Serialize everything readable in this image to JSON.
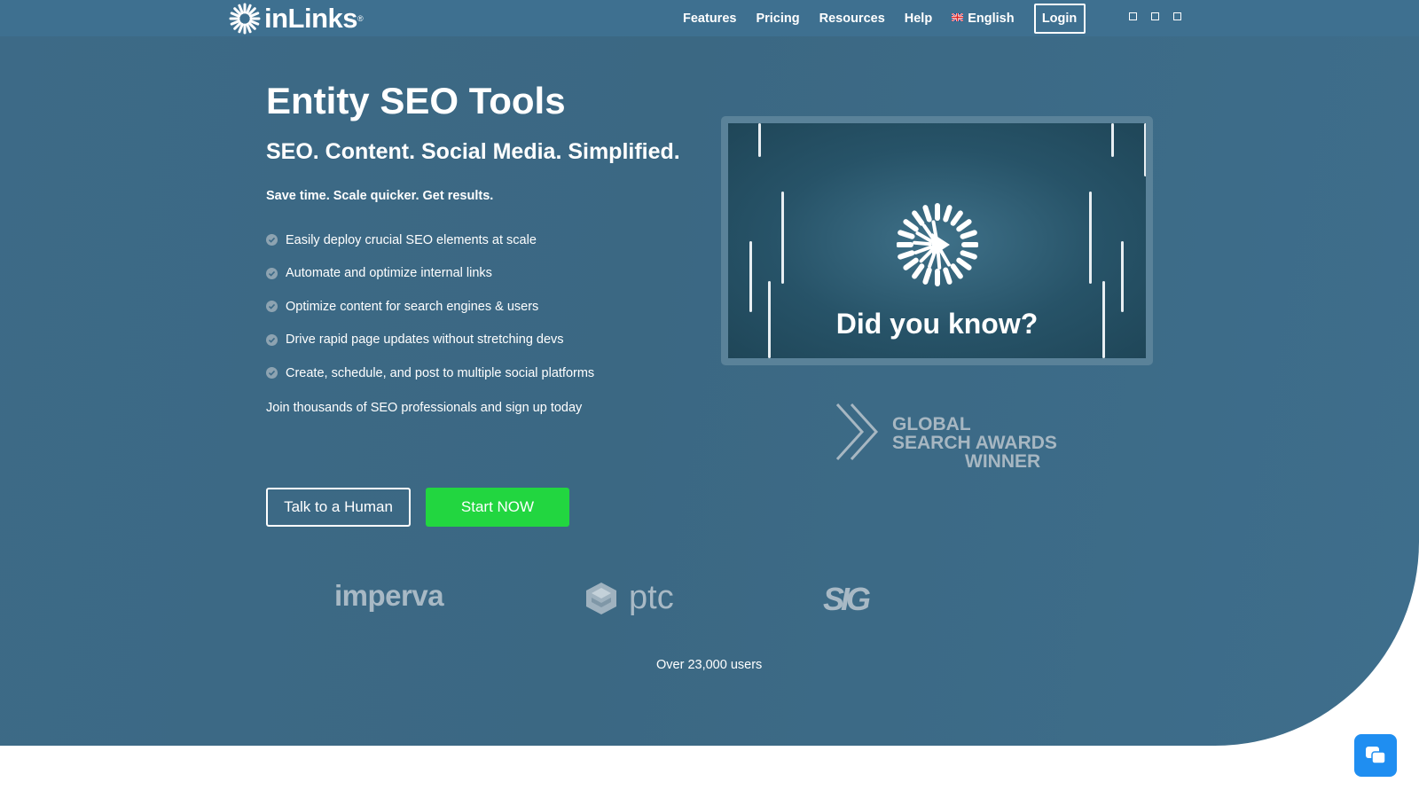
{
  "brand": {
    "logo_text": "inLinks",
    "registered": "®"
  },
  "nav": {
    "links": [
      "Features",
      "Pricing",
      "Resources",
      "Help"
    ],
    "language": "English",
    "login": "Login"
  },
  "hero": {
    "title": "Entity SEO Tools",
    "subtitle": "SEO. Content. Social Media. Simplified.",
    "tagline": "Save time. Scale quicker. Get results.",
    "features": [
      "Easily deploy crucial SEO elements at scale",
      "Automate and optimize internal links",
      "Optimize content for search engines & users",
      "Drive rapid page updates without stretching devs",
      "Create, schedule, and post to multiple social platforms"
    ],
    "join_text": "Join thousands of SEO professionals and sign up today",
    "buttons": {
      "talk": "Talk to a Human",
      "start": "Start NOW"
    }
  },
  "video": {
    "caption": "Did you know?"
  },
  "award": {
    "line1": "GLOBAL",
    "line2": "SEARCH AWARDS",
    "line3": "WINNER"
  },
  "clients": {
    "logos": [
      "imperva",
      "ptc",
      "SIG"
    ],
    "users_text": "Over 23,000 users"
  },
  "colors": {
    "hero_bg": "#3d6a87",
    "nav_bg": "#3e7090",
    "cta_green": "#22d640",
    "chat_blue": "#1f8ef1"
  }
}
